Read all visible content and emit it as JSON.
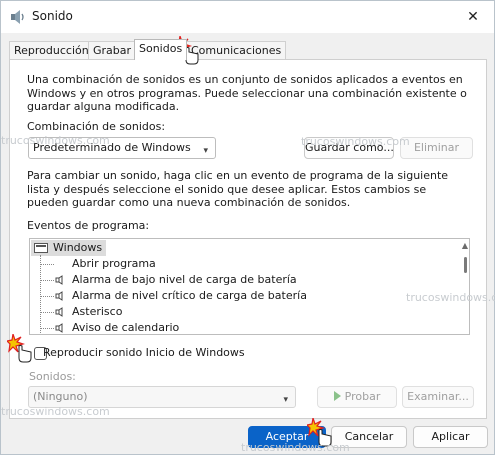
{
  "window": {
    "title": "Sonido",
    "close": "✕"
  },
  "tabs": [
    {
      "label": "Reproducción"
    },
    {
      "label": "Grabar"
    },
    {
      "label": "Sonidos"
    },
    {
      "label": "Comunicaciones"
    }
  ],
  "intro": "Una combinación de sonidos es un conjunto de sonidos aplicados a eventos en Windows y en otros programas. Puede seleccionar una combinación existente o guardar alguna modificada.",
  "scheme": {
    "label": "Combinación de sonidos:",
    "value": "Predeterminado de Windows",
    "save_button": "Guardar como...",
    "delete_button": "Eliminar"
  },
  "instructions": "Para cambiar un sonido, haga clic en un evento de programa de la siguiente lista y después seleccione el sonido que desee aplicar. Estos cambios se pueden guardar como una nueva combinación de sonidos.",
  "events": {
    "label": "Eventos de programa:",
    "group": "Windows",
    "items": [
      "Abrir programa",
      "Alarma de bajo nivel de carga de batería",
      "Alarma de nivel crítico de carga de batería",
      "Asterisco",
      "Aviso de calendario"
    ]
  },
  "startup": {
    "label": "Reproducir sonido Inicio de Windows",
    "checked": false
  },
  "sounds": {
    "label": "Sonidos:",
    "value": "(Ninguno)",
    "test_button": "Probar",
    "browse_button": "Examinar..."
  },
  "footer": {
    "ok": "Aceptar",
    "cancel": "Cancelar",
    "apply": "Aplicar"
  },
  "watermark": "trucoswindows.com"
}
